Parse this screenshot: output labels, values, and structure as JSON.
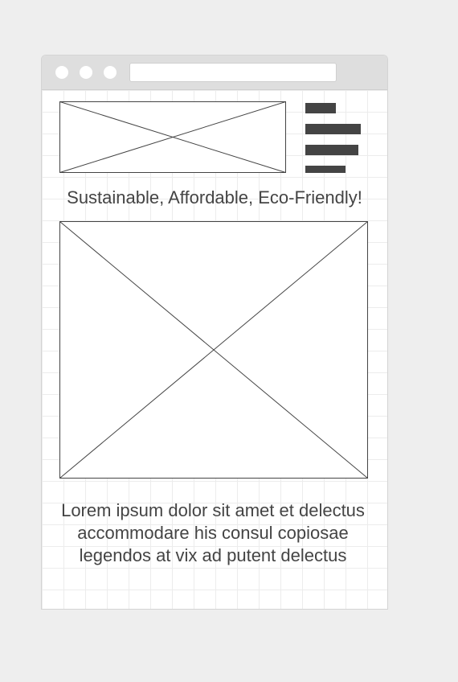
{
  "window": {
    "controls": [
      "close",
      "minimize",
      "maximize"
    ],
    "address_bar_value": ""
  },
  "header": {
    "logo_placeholder": "image-placeholder",
    "menu_icon": "hamburger-menu-icon"
  },
  "hero": {
    "tagline": "Sustainable, Affordable, Eco-Friendly!",
    "image_placeholder": "image-placeholder"
  },
  "body": {
    "text": "Lorem ipsum dolor sit amet et delectus accommodare his consul copiosae legendos at vix ad putent delectus"
  },
  "colors": {
    "background": "#eeeeee",
    "titlebar": "#dedede",
    "text": "#444444",
    "wireframe_line": "#444444"
  }
}
